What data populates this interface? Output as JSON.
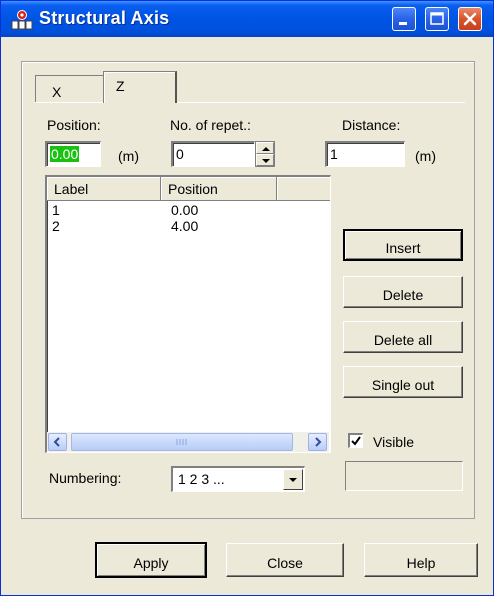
{
  "window": {
    "title": "Structural Axis"
  },
  "tabs": [
    {
      "label": "X",
      "active": false
    },
    {
      "label": "Z",
      "active": true
    }
  ],
  "form": {
    "position_label": "Position:",
    "position_value": "0.00",
    "position_unit": "(m)",
    "repet_label": "No. of repet.:",
    "repet_value": "0",
    "distance_label": "Distance:",
    "distance_value": "1",
    "distance_unit": "(m)"
  },
  "list": {
    "columns": [
      "Label",
      "Position"
    ],
    "rows": [
      {
        "label": "1",
        "position": "0.00"
      },
      {
        "label": "2",
        "position": "4.00"
      }
    ]
  },
  "side_buttons": {
    "insert": "Insert",
    "delete": "Delete",
    "delete_all": "Delete all",
    "single_out": "Single out"
  },
  "visible": {
    "label": "Visible",
    "checked": true
  },
  "numbering": {
    "label": "Numbering:",
    "value": "1 2 3 ..."
  },
  "footer": {
    "apply": "Apply",
    "close": "Close",
    "help": "Help"
  },
  "colors": {
    "titlebar": "#0055e5",
    "highlight": "#19c20f",
    "dialog_bg": "#ece9d8"
  }
}
